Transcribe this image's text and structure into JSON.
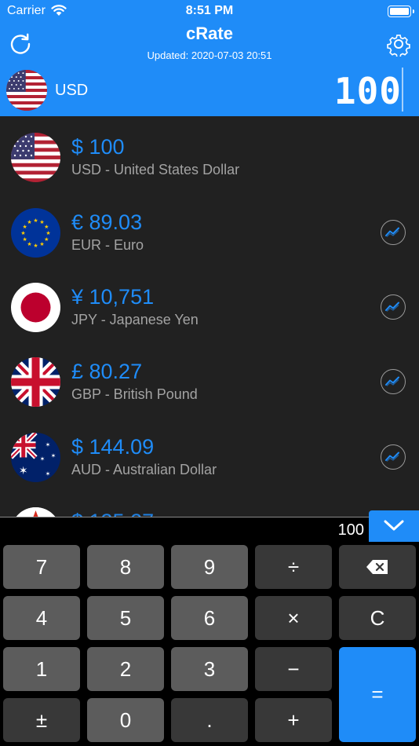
{
  "status_bar": {
    "carrier": "Carrier",
    "time": "8:51 PM"
  },
  "header": {
    "title": "cRate",
    "updated": "Updated: 2020-07-03 20:51",
    "base_code": "USD",
    "base_amount": "100"
  },
  "rates": [
    {
      "amount": "$ 100",
      "name": "USD - United States Dollar",
      "flag": "us-flag"
    },
    {
      "amount": "€ 89.03",
      "name": "EUR - Euro",
      "flag": "eu-flag"
    },
    {
      "amount": "¥ 10,751",
      "name": "JPY - Japanese Yen",
      "flag": "jp-flag"
    },
    {
      "amount": "£ 80.27",
      "name": "GBP - British Pound",
      "flag": "gb-flag"
    },
    {
      "amount": "$ 144.09",
      "name": "AUD - Australian Dollar",
      "flag": "au-flag"
    }
  ],
  "calculator": {
    "expression": "100",
    "keys": [
      "7",
      "8",
      "9",
      "÷",
      "4",
      "5",
      "6",
      "×",
      "C",
      "1",
      "2",
      "3",
      "−",
      "=",
      "±",
      "0",
      ".",
      "+"
    ]
  },
  "colors": {
    "accent": "#1f8cf8",
    "background": "#212121",
    "key": "#5c5c5c",
    "operator_key": "#383838"
  }
}
